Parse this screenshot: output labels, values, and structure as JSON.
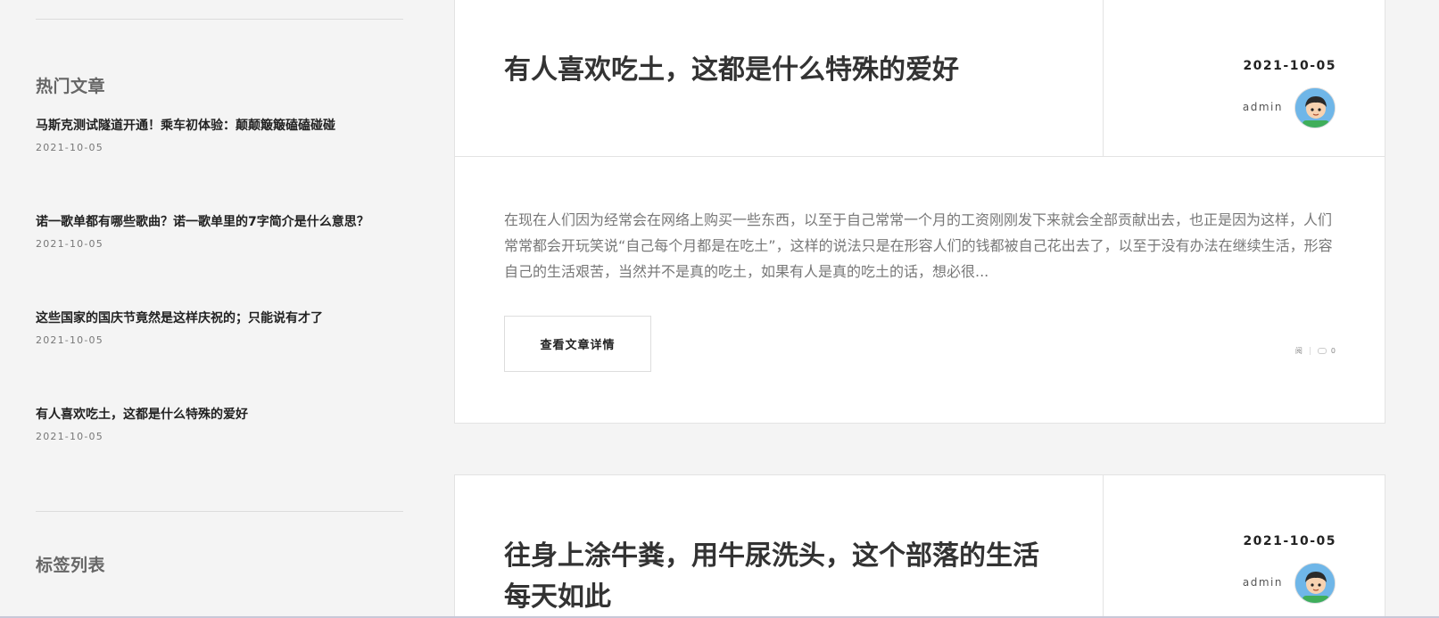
{
  "sidebar": {
    "hot_title": "热门文章",
    "hot_items": [
      {
        "title": "马斯克测试隧道开通！乘车初体验：颠颠簸簸磕磕碰碰",
        "date": "2021-10-05"
      },
      {
        "title": "诺一歌单都有哪些歌曲？诺一歌单里的7字简介是什么意思？",
        "date": "2021-10-05"
      },
      {
        "title": "这些国家的国庆节竟然是这样庆祝的；只能说有才了",
        "date": "2021-10-05"
      },
      {
        "title": "有人喜欢吃土，这都是什么特殊的爱好",
        "date": "2021-10-05"
      }
    ],
    "tags_title": "标签列表"
  },
  "posts": [
    {
      "title": "有人喜欢吃土，这都是什么特殊的爱好",
      "date": "2021-10-05",
      "author": "admin",
      "excerpt": "在现在人们因为经常会在网络上购买一些东西，以至于自己常常一个月的工资刚刚发下来就会全部贡献出去，也正是因为这样，人们常常都会开玩笑说“自己每个月都是在吃土”，这样的说法只是在形容人们的钱都被自己花出去了，以至于没有办法在继续生活，形容自己的生活艰苦，当然并不是真的吃土，如果有人是真的吃土的话，想必很...",
      "button_label": "查看文章详情",
      "views_label": "阅",
      "comments": "0"
    },
    {
      "title": "往身上涂牛粪，用牛尿洗头，这个部落的生活每天如此",
      "date": "2021-10-05",
      "author": "admin"
    }
  ],
  "colors": {
    "background": "#f4f4f4",
    "card": "#ffffff",
    "avatar_bg": "#6fb6e8"
  },
  "icons": [
    "avatar-icon",
    "comment-icon"
  ]
}
